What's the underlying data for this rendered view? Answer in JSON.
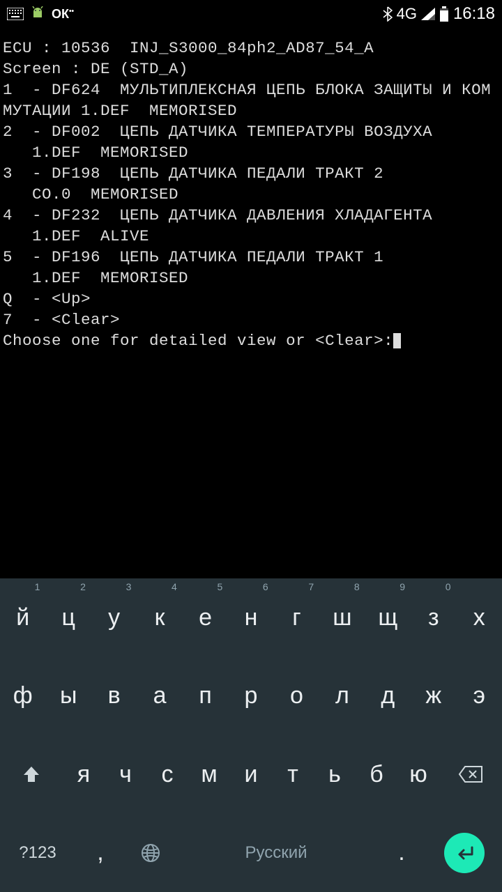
{
  "status": {
    "network": "4G",
    "time": "16:18"
  },
  "terminal": {
    "l1": "ECU : 10536  INJ_S3000_84ph2_AD87_54_A",
    "l2": "Screen : DE (STD_A)",
    "l3": "1  - DF624  МУЛЬТИПЛЕКСНАЯ ЦЕПЬ БЛОКА ЗАЩИТЫ И КОММУТАЦИИ 1.DEF  MEMORISED",
    "l4": "2  - DF002  ЦЕПЬ ДАТЧИКА ТЕМПЕРАТУРЫ ВОЗДУХА",
    "l5": "   1.DEF  MEMORISED",
    "l6": "3  - DF198  ЦЕПЬ ДАТЧИКА ПЕДАЛИ ТРАКТ 2",
    "l7": "   CO.0  MEMORISED",
    "l8": "4  - DF232  ЦЕПЬ ДАТЧИКА ДАВЛЕНИЯ ХЛАДАГЕНТА",
    "l9": "   1.DEF  ALIVE",
    "l10": "5  - DF196  ЦЕПЬ ДАТЧИКА ПЕДАЛИ ТРАКТ 1",
    "l11": "   1.DEF  MEMORISED",
    "l12": "Q  - <Up>",
    "l13": "7  - <Clear>",
    "l14": "Choose one for detailed view or <Clear>:"
  },
  "keyboard": {
    "row1": [
      {
        "k": "й",
        "h": "1"
      },
      {
        "k": "ц",
        "h": "2"
      },
      {
        "k": "у",
        "h": "3"
      },
      {
        "k": "к",
        "h": "4"
      },
      {
        "k": "е",
        "h": "5"
      },
      {
        "k": "н",
        "h": "6"
      },
      {
        "k": "г",
        "h": "7"
      },
      {
        "k": "ш",
        "h": "8"
      },
      {
        "k": "щ",
        "h": "9"
      },
      {
        "k": "з",
        "h": "0"
      },
      {
        "k": "х",
        "h": ""
      }
    ],
    "row2": [
      {
        "k": "ф"
      },
      {
        "k": "ы"
      },
      {
        "k": "в"
      },
      {
        "k": "а"
      },
      {
        "k": "п"
      },
      {
        "k": "р"
      },
      {
        "k": "о"
      },
      {
        "k": "л"
      },
      {
        "k": "д"
      },
      {
        "k": "ж"
      },
      {
        "k": "э"
      }
    ],
    "row3": [
      {
        "k": "я"
      },
      {
        "k": "ч"
      },
      {
        "k": "с"
      },
      {
        "k": "м"
      },
      {
        "k": "и"
      },
      {
        "k": "т"
      },
      {
        "k": "ь"
      },
      {
        "k": "б"
      },
      {
        "k": "ю"
      }
    ],
    "sym": "?123",
    "comma": ",",
    "space": "Русский",
    "period": "."
  }
}
